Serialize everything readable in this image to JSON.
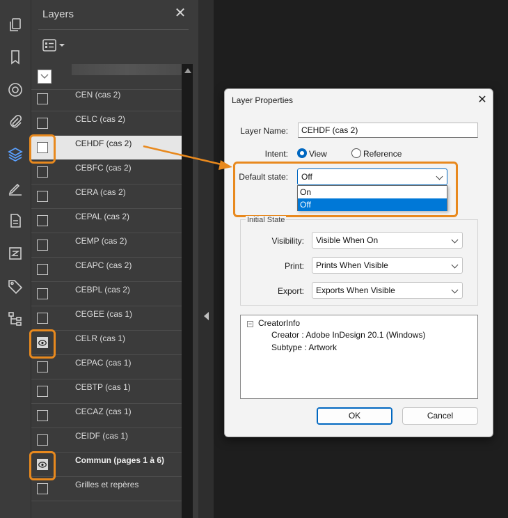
{
  "panel": {
    "title": "Layers",
    "close_glyph": "✕",
    "layers": [
      {
        "label": "CEN (cas 2)",
        "visible": false
      },
      {
        "label": "CELC (cas 2)",
        "visible": false
      },
      {
        "label": "CEHDF (cas 2)",
        "visible": false,
        "selected": true
      },
      {
        "label": "CEBFC (cas 2)",
        "visible": false
      },
      {
        "label": "CERA (cas 2)",
        "visible": false
      },
      {
        "label": "CEPAL (cas 2)",
        "visible": false
      },
      {
        "label": "CEMP (cas 2)",
        "visible": false
      },
      {
        "label": "CEAPC (cas 2)",
        "visible": false
      },
      {
        "label": "CEBPL (cas 2)",
        "visible": false
      },
      {
        "label": "CEGEE (cas 1)",
        "visible": false
      },
      {
        "label": "CELR (cas 1)",
        "visible": true
      },
      {
        "label": "CEPAC (cas 1)",
        "visible": false
      },
      {
        "label": "CEBTP (cas 1)",
        "visible": false
      },
      {
        "label": "CECAZ (cas 1)",
        "visible": false
      },
      {
        "label": "CEIDF (cas 1)",
        "visible": false
      },
      {
        "label": "Commun (pages 1 à 6)",
        "visible": true,
        "bold": true
      },
      {
        "label": "Grilles et repères",
        "visible": false
      }
    ]
  },
  "rail_icons": [
    "pages-icon",
    "bookmark-icon",
    "target-icon",
    "attachment-icon",
    "layers-icon",
    "signature-icon",
    "document-icon",
    "compare-icon",
    "tag-icon",
    "structure-icon"
  ],
  "dialog": {
    "title": "Layer Properties",
    "close_glyph": "✕",
    "layer_name_label": "Layer Name:",
    "layer_name_value": "CEHDF (cas 2)",
    "intent_label": "Intent:",
    "intent_options": [
      "View",
      "Reference"
    ],
    "intent_selected": "View",
    "default_state_label": "Default state:",
    "default_state_value": "Off",
    "default_state_options": [
      "On",
      "Off"
    ],
    "initial_state_title": "Initial State",
    "visibility_label": "Visibility:",
    "visibility_value": "Visible When On",
    "print_label": "Print:",
    "print_value": "Prints When Visible",
    "export_label": "Export:",
    "export_value": "Exports When Visible",
    "tree": {
      "toggle": "−",
      "root": "CreatorInfo",
      "creator": "Creator : Adobe InDesign 20.1 (Windows)",
      "subtype": "Subtype : Artwork"
    },
    "ok_label": "OK",
    "cancel_label": "Cancel"
  },
  "colors": {
    "accent": "#0067c0",
    "callout": "#e8891e",
    "panel_bg": "#3b3b3b"
  }
}
